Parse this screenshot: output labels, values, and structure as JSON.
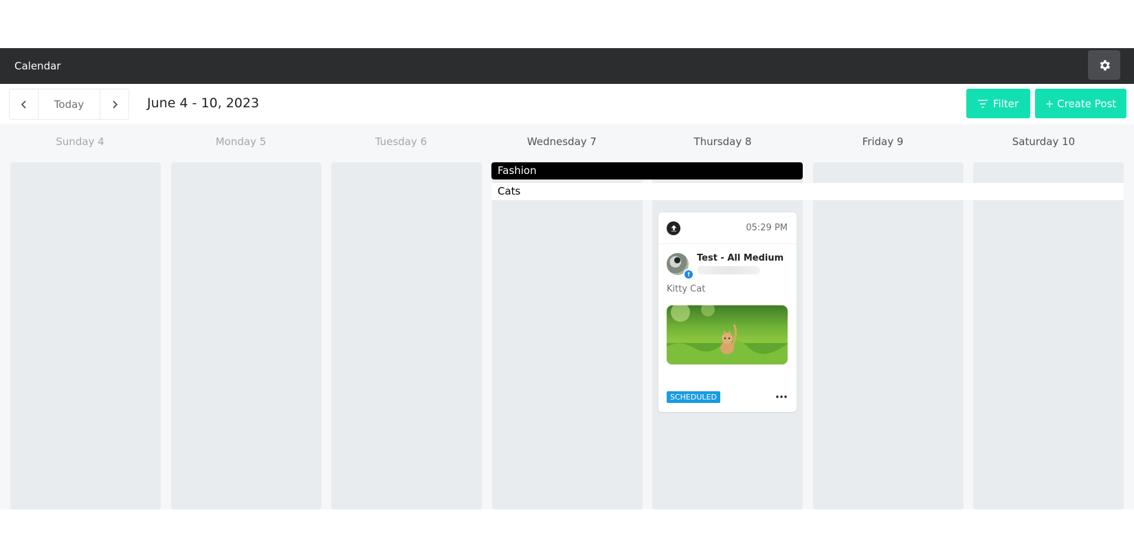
{
  "app": {
    "title": "Calendar"
  },
  "header": {
    "settings_icon": "gear-icon"
  },
  "toolbar": {
    "prev_icon": "chevron-left-icon",
    "today_label": "Today",
    "next_icon": "chevron-right-icon",
    "date_range": "June 4 - 10, 2023",
    "filter_label": "Filter",
    "create_label": "+ Create Post"
  },
  "colors": {
    "accent": "#13e0b2",
    "topbar": "#2c2d2f",
    "scheduled": "#1a9be0",
    "facebook": "#1a87f2"
  },
  "days": [
    {
      "label": "Sunday 4"
    },
    {
      "label": "Monday 5"
    },
    {
      "label": "Tuesday 6"
    },
    {
      "label": "Wednesday 7"
    },
    {
      "label": "Thursday 8"
    },
    {
      "label": "Friday 9"
    },
    {
      "label": "Saturday 10"
    }
  ],
  "events": [
    {
      "label": "Fashion"
    },
    {
      "label": "Cats"
    }
  ],
  "post": {
    "type_icon": "upload-icon",
    "time": "05:29 PM",
    "account_name": "Test - All Medium",
    "network_icon": "facebook-icon",
    "caption": "Kitty Cat",
    "status": "SCHEDULED",
    "more_icon": "more-horizontal-icon"
  }
}
